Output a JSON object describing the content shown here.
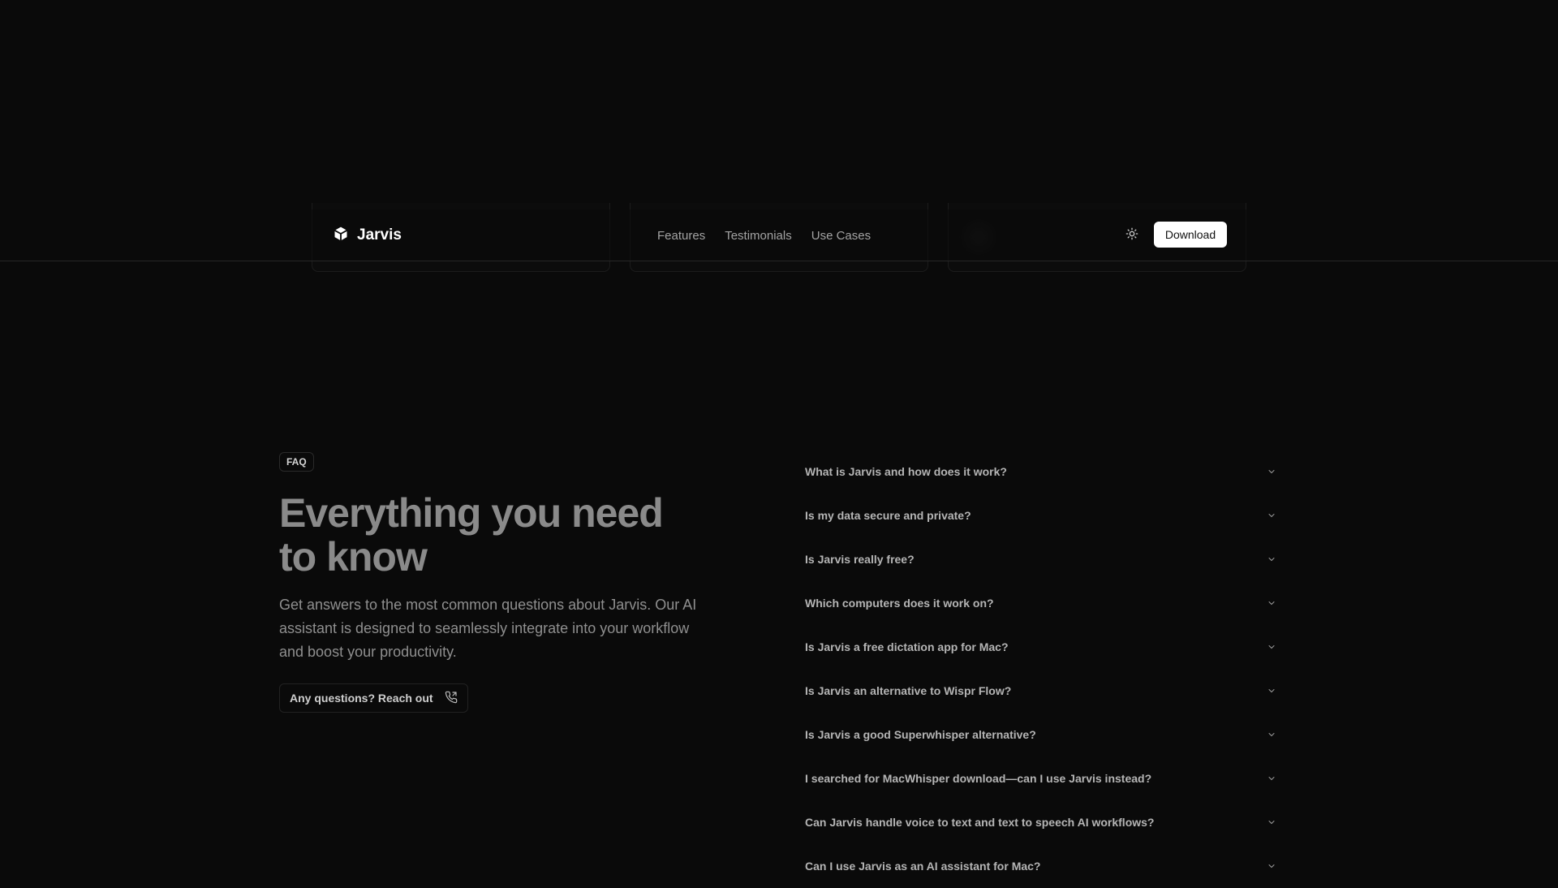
{
  "nav": {
    "brand": "Jarvis",
    "links": [
      "Features",
      "Testimonials",
      "Use Cases"
    ],
    "theme_icon": "sun-icon",
    "download_label": "Download"
  },
  "faq": {
    "badge": "FAQ",
    "title": "Everything you need to know",
    "description": "Get answers to the most common questions about Jarvis. Our AI assistant is designed to seamlessly integrate into your workflow and boost your productivity.",
    "cta_label": "Any questions? Reach out",
    "cta_icon": "phone-icon",
    "questions": [
      "What is Jarvis and how does it work?",
      "Is my data secure and private?",
      "Is Jarvis really free?",
      "Which computers does it work on?",
      "Is Jarvis a free dictation app for Mac?",
      "Is Jarvis an alternative to Wispr Flow?",
      "Is Jarvis a good Superwhisper alternative?",
      "I searched for MacWhisper download—can I use Jarvis instead?",
      "Can Jarvis handle voice to text and text to speech AI workflows?",
      "Can I use Jarvis as an AI assistant for Mac?"
    ]
  },
  "colors": {
    "background": "#0a0a0a",
    "border": "#262626",
    "button_bg": "#ffffff"
  }
}
